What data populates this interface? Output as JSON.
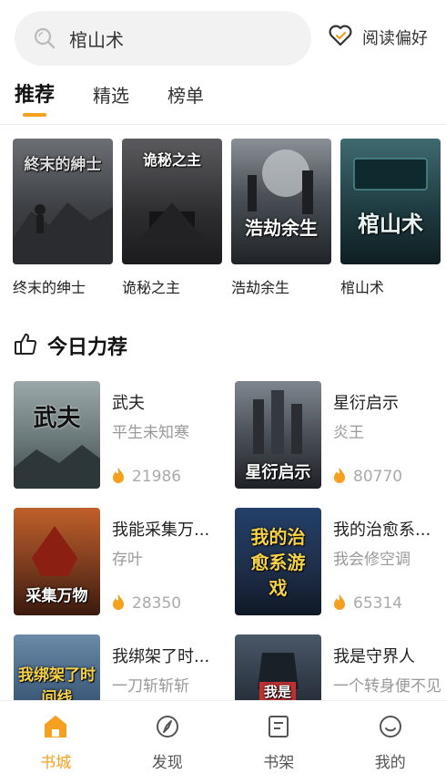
{
  "search": {
    "query": "棺山术",
    "icon": "search-icon"
  },
  "preference": {
    "label": "阅读偏好",
    "icon": "heart-icon"
  },
  "tabs": [
    {
      "label": "推荐",
      "active": true
    },
    {
      "label": "精选",
      "active": false
    },
    {
      "label": "榜单",
      "active": false
    }
  ],
  "featured": [
    {
      "title": "终末的绅士",
      "cover_text": "終末的紳士",
      "cover_color": "#4a4d52"
    },
    {
      "title": "诡秘之主",
      "cover_text": "诡秘之主",
      "cover_color": "#3a3a3c"
    },
    {
      "title": "浩劫余生",
      "cover_text": "浩劫余生",
      "cover_color": "#2e3338"
    },
    {
      "title": "棺山术",
      "cover_text": "棺山术",
      "cover_color": "#1e3e44"
    }
  ],
  "section": {
    "title": "今日力荐",
    "icon": "thumbs-up-icon"
  },
  "books": [
    {
      "title": "武夫",
      "author": "平生未知寒",
      "heat": "21986",
      "cover_text": "武夫",
      "cover_color": "#7a8a8c"
    },
    {
      "title": "星衍启示",
      "author": "炎王",
      "heat": "80770",
      "cover_text": "星衍启示",
      "cover_color": "#4b5058"
    },
    {
      "title": "我能采集万...",
      "author": "存叶",
      "heat": "28350",
      "cover_text": "采集万物",
      "cover_color": "#7a3b1e"
    },
    {
      "title": "我的治愈系...",
      "author": "我会修空调",
      "heat": "65314",
      "cover_text": "我的治愈系游戏",
      "cover_color": "#1f2f4a"
    },
    {
      "title": "我绑架了时...",
      "author": "一刀斩斩斩",
      "heat": "",
      "cover_text": "我绑架了时间线",
      "cover_color": "#3d5a7a"
    },
    {
      "title": "我是守界人",
      "author": "一个转身便不见",
      "heat": "",
      "cover_text": "我是",
      "cover_color": "#28303c"
    }
  ],
  "nav": [
    {
      "label": "书城",
      "icon": "home-icon",
      "active": true
    },
    {
      "label": "发现",
      "icon": "compass-icon",
      "active": false
    },
    {
      "label": "书架",
      "icon": "bookshelf-icon",
      "active": false
    },
    {
      "label": "我的",
      "icon": "profile-icon",
      "active": false
    }
  ],
  "colors": {
    "accent": "#f5a01e",
    "muted": "#999999"
  }
}
